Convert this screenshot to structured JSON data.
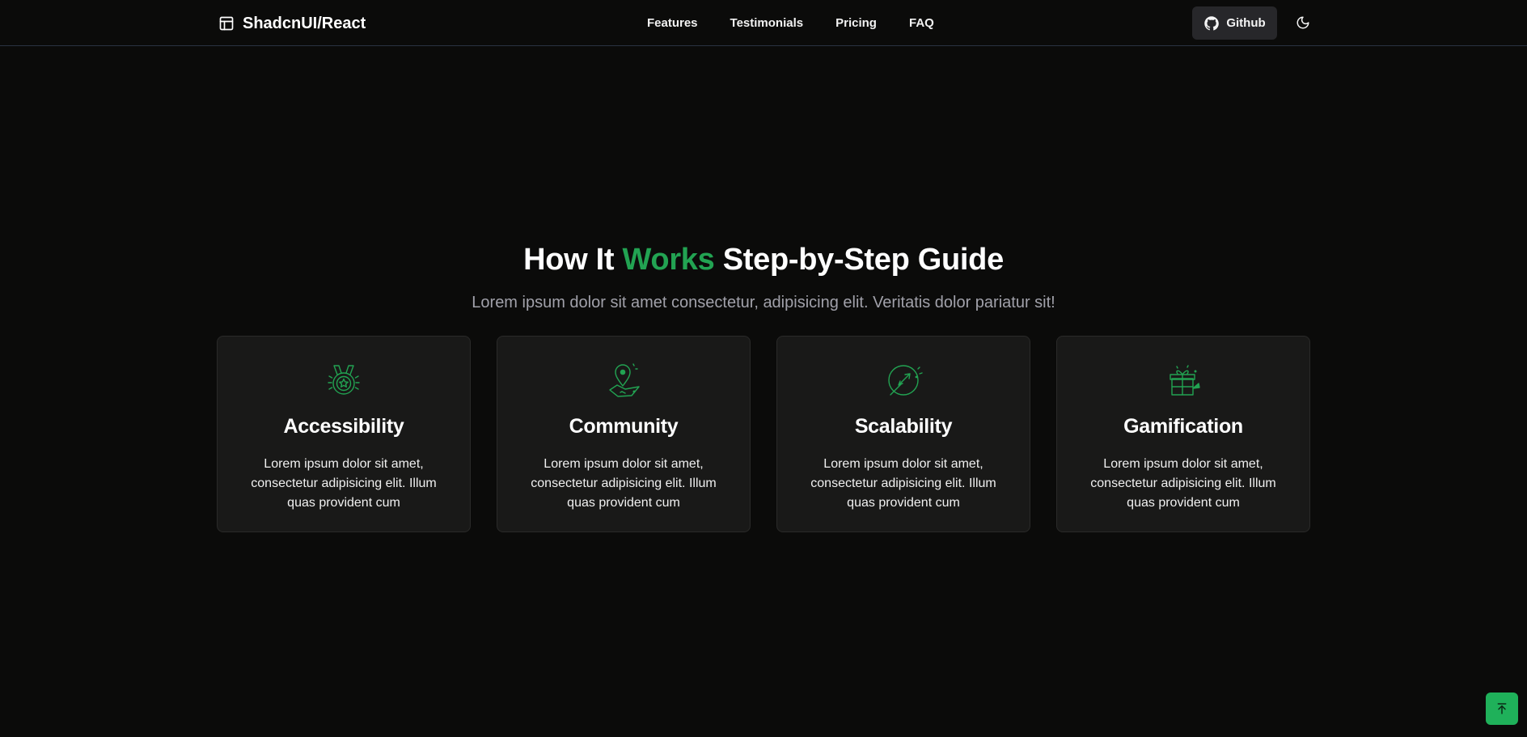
{
  "nav": {
    "brand": "ShadcnUI/React",
    "links": [
      "Features",
      "Testimonials",
      "Pricing",
      "FAQ"
    ],
    "github_label": "Github"
  },
  "hero": {
    "title_before": "How It ",
    "title_accent": "Works",
    "title_after": " Step-by-Step Guide",
    "subtitle": "Lorem ipsum dolor sit amet consectetur, adipisicing elit. Veritatis dolor pariatur sit!"
  },
  "cards": [
    {
      "icon": "medal-icon",
      "title": "Accessibility",
      "description": "Lorem ipsum dolor sit amet, consectetur adipisicing elit. Illum quas provident cum"
    },
    {
      "icon": "map-pin-icon",
      "title": "Community",
      "description": "Lorem ipsum dolor sit amet, consectetur adipisicing elit. Illum quas provident cum"
    },
    {
      "icon": "plane-globe-icon",
      "title": "Scalability",
      "description": "Lorem ipsum dolor sit amet, consectetur adipisicing elit. Illum quas provident cum"
    },
    {
      "icon": "gift-icon",
      "title": "Gamification",
      "description": "Lorem ipsum dolor sit amet, consectetur adipisicing elit. Illum quas provident cum"
    }
  ],
  "colors": {
    "accent": "#22a352",
    "background": "#0b0b0a",
    "card": "#191918",
    "scroll_button": "#1fb15a"
  }
}
